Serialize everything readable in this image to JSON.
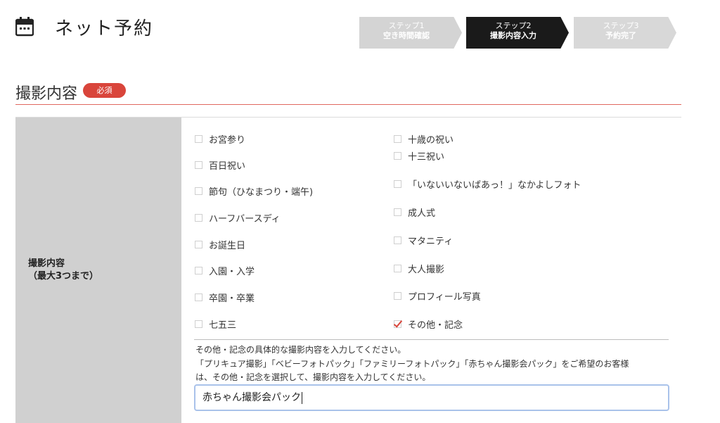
{
  "header": {
    "title": "ネット予約"
  },
  "steps": [
    {
      "num": "ステップ1",
      "label": "空き時間確認",
      "state": "done"
    },
    {
      "num": "ステップ2",
      "label": "撮影内容入力",
      "state": "active"
    },
    {
      "num": "ステップ3",
      "label": "予約完了",
      "state": "pending"
    }
  ],
  "section": {
    "title": "撮影内容",
    "badge": "必須"
  },
  "form": {
    "label_line1": "撮影内容",
    "label_line2": "（最大3つまで）",
    "left_options": [
      {
        "label": "お宮参り",
        "checked": false
      },
      {
        "label": "百日祝い",
        "checked": false
      },
      {
        "label": "節句（ひなまつり・端午)",
        "checked": false
      },
      {
        "label": "ハーフバースディ",
        "checked": false
      },
      {
        "label": "お誕生日",
        "checked": false
      },
      {
        "label": "入園・入学",
        "checked": false
      },
      {
        "label": "卒園・卒業",
        "checked": false
      },
      {
        "label": "七五三",
        "checked": false
      }
    ],
    "right_options": [
      {
        "label": "十歳の祝い",
        "checked": false
      },
      {
        "label": "十三祝い",
        "checked": false
      },
      {
        "label": "「いないいないばあっ！」なかよしフォト",
        "checked": false
      },
      {
        "label": "成人式",
        "checked": false
      },
      {
        "label": "マタニティ",
        "checked": false
      },
      {
        "label": "大人撮影",
        "checked": false
      },
      {
        "label": "プロフィール写真",
        "checked": false
      },
      {
        "label": "その他・記念",
        "checked": true
      }
    ],
    "note_line1": "その他・記念の具体的な撮影内容を入力してください。",
    "note_line2": "「プリキュア撮影」「ベビーフォトパック」「ファミリーフォトパック」「赤ちゃん撮影会パック」をご希望のお客様",
    "note_line3": "は、その他・記念を選択して、撮影内容を入力してください。",
    "other_value": "赤ちゃん撮影会パック"
  },
  "colors": {
    "accent_red": "#d9453b",
    "step_active": "#1a1a1a",
    "step_inactive": "#d4d4d4",
    "label_bg": "#d0d0d0",
    "input_focus": "#a9c2ea"
  },
  "icons": {
    "calendar": "calendar-icon"
  }
}
